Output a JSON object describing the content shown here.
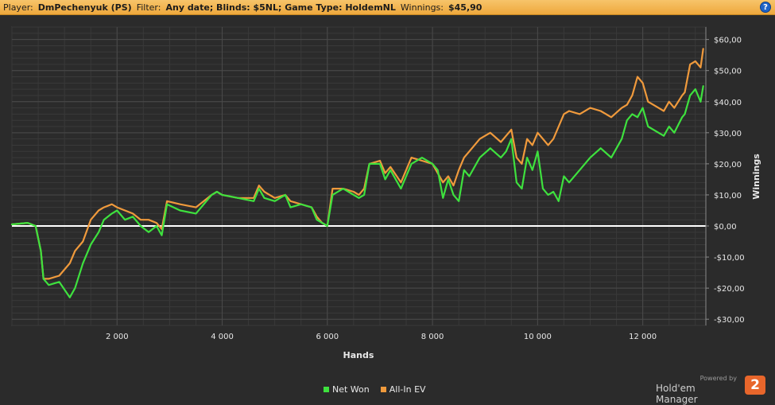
{
  "header": {
    "player_label": "Player:",
    "player_value": "DmPechenyuk (PS)",
    "filter_label": "Filter:",
    "filter_value": "Any date; Blinds: $5NL; Game Type: HoldemNL",
    "winnings_label": "Winnings:",
    "winnings_value": "$45,90",
    "help_glyph": "?"
  },
  "legend": {
    "net_won": "Net Won",
    "all_in_ev": "All-In EV"
  },
  "brand": {
    "powered": "Powered by",
    "name": "Hold'em Manager",
    "logo": "2"
  },
  "colors": {
    "net_won": "#3ee13e",
    "all_in_ev": "#f09a3c",
    "zero_line": "#ffffff",
    "background": "#2b2b2b",
    "grid": "#4a4a4a"
  },
  "chart_data": {
    "type": "line",
    "xlabel": "Hands",
    "ylabel": "Winnings",
    "xlim": [
      0,
      13200
    ],
    "ylim": [
      -32,
      64
    ],
    "x_ticks": [
      2000,
      4000,
      6000,
      8000,
      10000,
      12000
    ],
    "x_tick_labels": [
      "2 000",
      "4 000",
      "6 000",
      "8 000",
      "10 000",
      "12 000"
    ],
    "y_ticks": [
      60,
      50,
      40,
      30,
      20,
      10,
      0,
      -10,
      -20,
      -30
    ],
    "y_tick_labels": [
      "$60,00",
      "$50,00",
      "$40,00",
      "$30,00",
      "$20,00",
      "$10,00",
      "$0,00",
      "-$10,00",
      "-$20,00",
      "-$30,00"
    ],
    "grid": true,
    "y_axis_side": "right",
    "legend_position": "bottom-center",
    "series": [
      {
        "name": "Net Won",
        "x": [
          0,
          300,
          450,
          550,
          600,
          700,
          900,
          1100,
          1200,
          1350,
          1500,
          1650,
          1750,
          1900,
          2000,
          2150,
          2300,
          2450,
          2600,
          2750,
          2850,
          2950,
          3200,
          3500,
          3800,
          3900,
          4000,
          4300,
          4600,
          4700,
          4800,
          5000,
          5200,
          5300,
          5500,
          5700,
          5800,
          5900,
          6000,
          6100,
          6300,
          6500,
          6600,
          6700,
          6800,
          7000,
          7100,
          7200,
          7400,
          7600,
          7800,
          8000,
          8100,
          8200,
          8300,
          8400,
          8500,
          8600,
          8700,
          8900,
          9100,
          9300,
          9400,
          9500,
          9600,
          9700,
          9800,
          9900,
          10000,
          10100,
          10200,
          10300,
          10400,
          10500,
          10600,
          10800,
          11000,
          11200,
          11400,
          11600,
          11700,
          11800,
          11900,
          12000,
          12100,
          12300,
          12400,
          12500,
          12600,
          12750,
          12800,
          12900,
          13000,
          13100,
          13150
        ],
        "y": [
          0.5,
          1,
          0,
          -8,
          -17,
          -19,
          -18,
          -23,
          -20,
          -12,
          -6,
          -2,
          2,
          4,
          5,
          2,
          3,
          0,
          -2,
          0,
          -3,
          7,
          5,
          4,
          10,
          11,
          10,
          9,
          8,
          12,
          9,
          8,
          10,
          6,
          7,
          6,
          2,
          1,
          0,
          10,
          12,
          10,
          9,
          10,
          20,
          20,
          15,
          18,
          12,
          20,
          22,
          20,
          18,
          9,
          15,
          10,
          8,
          18,
          16,
          22,
          25,
          22,
          24,
          28,
          14,
          12,
          22,
          18,
          24,
          12,
          10,
          11,
          8,
          16,
          14,
          18,
          22,
          25,
          22,
          28,
          34,
          36,
          35,
          38,
          32,
          30,
          29,
          32,
          30,
          35,
          36,
          42,
          44,
          40,
          45
        ]
      },
      {
        "name": "All-In EV",
        "x": [
          0,
          300,
          450,
          550,
          600,
          700,
          900,
          1100,
          1200,
          1350,
          1500,
          1650,
          1750,
          1900,
          2000,
          2150,
          2300,
          2450,
          2600,
          2750,
          2850,
          2950,
          3200,
          3500,
          3800,
          3900,
          4000,
          4300,
          4600,
          4700,
          4800,
          5000,
          5200,
          5300,
          5500,
          5700,
          5800,
          5900,
          6000,
          6100,
          6300,
          6500,
          6600,
          6700,
          6800,
          7000,
          7100,
          7200,
          7400,
          7600,
          7800,
          8000,
          8100,
          8200,
          8300,
          8400,
          8500,
          8600,
          8700,
          8900,
          9100,
          9300,
          9400,
          9500,
          9600,
          9700,
          9800,
          9900,
          10000,
          10100,
          10200,
          10300,
          10400,
          10500,
          10600,
          10800,
          11000,
          11200,
          11400,
          11600,
          11700,
          11800,
          11900,
          12000,
          12100,
          12300,
          12400,
          12500,
          12600,
          12750,
          12800,
          12900,
          13000,
          13100,
          13150
        ],
        "y": [
          0.5,
          1,
          0,
          -8,
          -17,
          -17,
          -16,
          -12,
          -8,
          -5,
          2,
          5,
          6,
          7,
          6,
          5,
          4,
          2,
          2,
          1,
          -1,
          8,
          7,
          6,
          10,
          11,
          10,
          9,
          9,
          13,
          11,
          9,
          10,
          8,
          7,
          6,
          3,
          1,
          0,
          12,
          12,
          11,
          10,
          12,
          20,
          21,
          17,
          19,
          14,
          22,
          21,
          20,
          17,
          14,
          16,
          13,
          18,
          22,
          24,
          28,
          30,
          27,
          29,
          31,
          22,
          20,
          28,
          26,
          30,
          28,
          26,
          28,
          32,
          36,
          37,
          36,
          38,
          37,
          35,
          38,
          39,
          42,
          48,
          46,
          40,
          38,
          37,
          40,
          38,
          42,
          43,
          52,
          53,
          51,
          57
        ]
      }
    ]
  }
}
